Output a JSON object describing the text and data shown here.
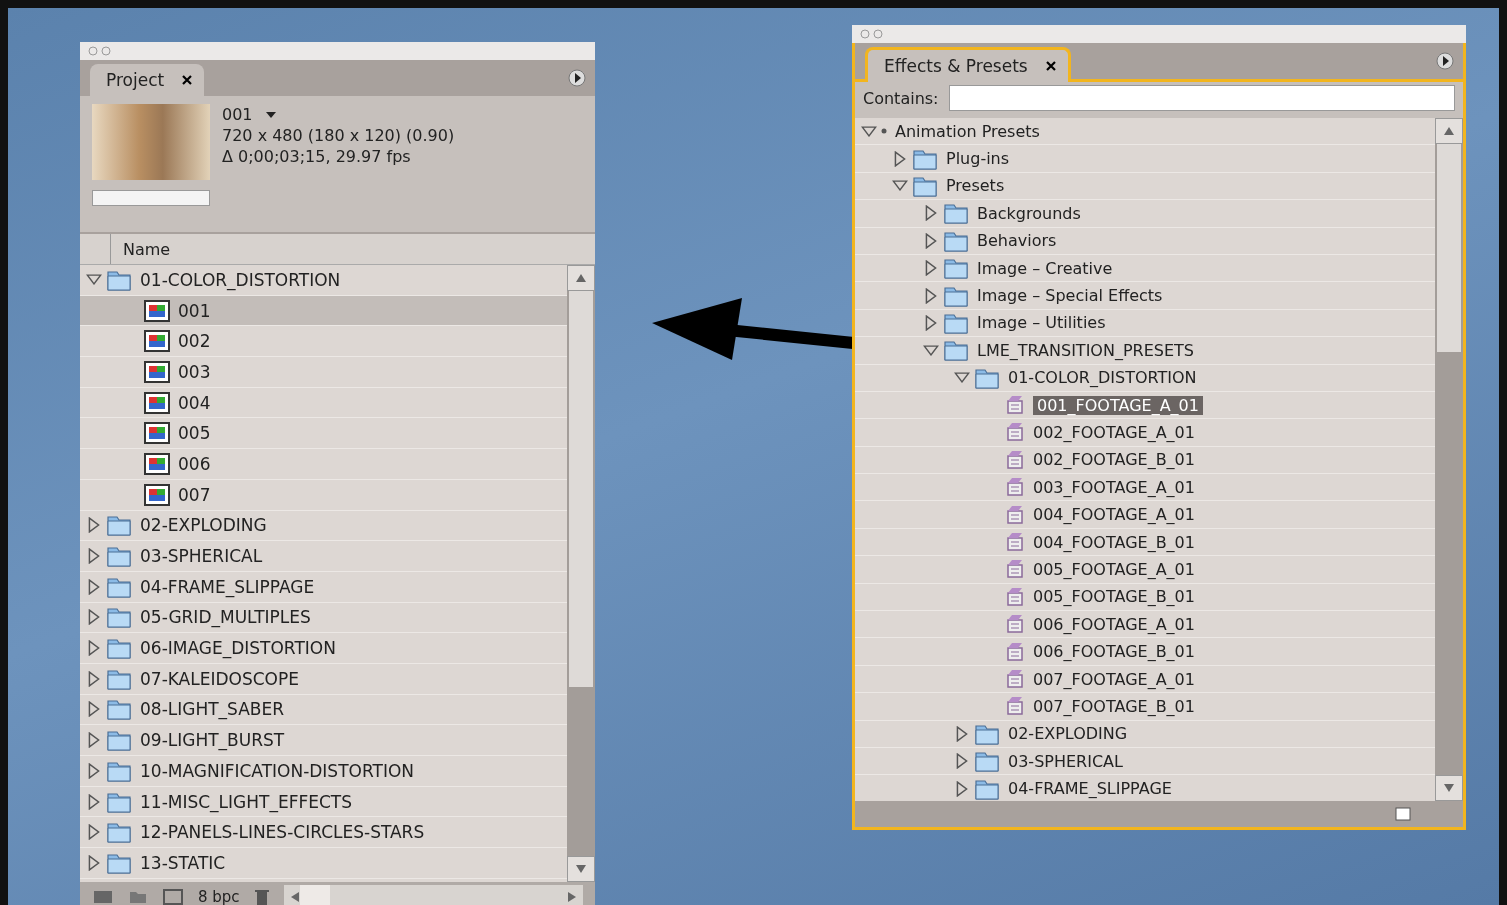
{
  "project_panel": {
    "tab": {
      "label": "Project"
    },
    "preview": {
      "name": "001",
      "dimensions": "720 x 480 (180 x 120) (0.90)",
      "duration": "Δ 0;00;03;15, 29.97 fps"
    },
    "column_header": "Name",
    "items": [
      {
        "label": "01-COLOR_DISTORTION",
        "kind": "folder",
        "expanded": true,
        "selected": false,
        "children": [
          {
            "label": "001",
            "kind": "footage",
            "selected": true
          },
          {
            "label": "002",
            "kind": "footage",
            "selected": false
          },
          {
            "label": "003",
            "kind": "footage",
            "selected": false
          },
          {
            "label": "004",
            "kind": "footage",
            "selected": false
          },
          {
            "label": "005",
            "kind": "footage",
            "selected": false
          },
          {
            "label": "006",
            "kind": "footage",
            "selected": false
          },
          {
            "label": "007",
            "kind": "footage",
            "selected": false
          }
        ]
      },
      {
        "label": "02-EXPLODING",
        "kind": "folder",
        "expanded": false,
        "selected": false
      },
      {
        "label": "03-SPHERICAL",
        "kind": "folder",
        "expanded": false,
        "selected": false
      },
      {
        "label": "04-FRAME_SLIPPAGE",
        "kind": "folder",
        "expanded": false,
        "selected": false
      },
      {
        "label": "05-GRID_MULTIPLES",
        "kind": "folder",
        "expanded": false,
        "selected": false
      },
      {
        "label": "06-IMAGE_DISTORTION",
        "kind": "folder",
        "expanded": false,
        "selected": false
      },
      {
        "label": "07-KALEIDOSCOPE",
        "kind": "folder",
        "expanded": false,
        "selected": false
      },
      {
        "label": "08-LIGHT_SABER",
        "kind": "folder",
        "expanded": false,
        "selected": false
      },
      {
        "label": "09-LIGHT_BURST",
        "kind": "folder",
        "expanded": false,
        "selected": false
      },
      {
        "label": "10-MAGNIFICATION-DISTORTION",
        "kind": "folder",
        "expanded": false,
        "selected": false
      },
      {
        "label": "11-MISC_LIGHT_EFFECTS",
        "kind": "folder",
        "expanded": false,
        "selected": false
      },
      {
        "label": "12-PANELS-LINES-CIRCLES-STARS",
        "kind": "folder",
        "expanded": false,
        "selected": false
      },
      {
        "label": "13-STATIC",
        "kind": "folder",
        "expanded": false,
        "selected": false
      }
    ],
    "footer": {
      "bit_depth": "8 bpc"
    }
  },
  "effects_panel": {
    "tab": {
      "label": "Effects & Presets"
    },
    "search": {
      "label": "Contains:"
    },
    "items": [
      {
        "label": "Animation Presets",
        "kind": "root",
        "expanded": true,
        "selected": false,
        "children": [
          {
            "label": "Plug-ins",
            "kind": "folder",
            "expanded": false,
            "selected": false
          },
          {
            "label": "Presets",
            "kind": "folder",
            "expanded": true,
            "selected": false,
            "children": [
              {
                "label": "Backgrounds",
                "kind": "folder",
                "expanded": false,
                "selected": false
              },
              {
                "label": "Behaviors",
                "kind": "folder",
                "expanded": false,
                "selected": false
              },
              {
                "label": "Image – Creative",
                "kind": "folder",
                "expanded": false,
                "selected": false
              },
              {
                "label": "Image – Special Effects",
                "kind": "folder",
                "expanded": false,
                "selected": false
              },
              {
                "label": "Image – Utilities",
                "kind": "folder",
                "expanded": false,
                "selected": false
              },
              {
                "label": "LME_TRANSITION_PRESETS",
                "kind": "folder",
                "expanded": true,
                "selected": false,
                "children": [
                  {
                    "label": "01-COLOR_DISTORTION",
                    "kind": "folder",
                    "expanded": true,
                    "selected": false,
                    "children": [
                      {
                        "label": "001_FOOTAGE_A_01",
                        "kind": "preset",
                        "selected": true
                      },
                      {
                        "label": "002_FOOTAGE_A_01",
                        "kind": "preset",
                        "selected": false
                      },
                      {
                        "label": "002_FOOTAGE_B_01",
                        "kind": "preset",
                        "selected": false
                      },
                      {
                        "label": "003_FOOTAGE_A_01",
                        "kind": "preset",
                        "selected": false
                      },
                      {
                        "label": "004_FOOTAGE_A_01",
                        "kind": "preset",
                        "selected": false
                      },
                      {
                        "label": "004_FOOTAGE_B_01",
                        "kind": "preset",
                        "selected": false
                      },
                      {
                        "label": "005_FOOTAGE_A_01",
                        "kind": "preset",
                        "selected": false
                      },
                      {
                        "label": "005_FOOTAGE_B_01",
                        "kind": "preset",
                        "selected": false
                      },
                      {
                        "label": "006_FOOTAGE_A_01",
                        "kind": "preset",
                        "selected": false
                      },
                      {
                        "label": "006_FOOTAGE_B_01",
                        "kind": "preset",
                        "selected": false
                      },
                      {
                        "label": "007_FOOTAGE_A_01",
                        "kind": "preset",
                        "selected": false
                      },
                      {
                        "label": "007_FOOTAGE_B_01",
                        "kind": "preset",
                        "selected": false
                      }
                    ]
                  },
                  {
                    "label": "02-EXPLODING",
                    "kind": "folder",
                    "expanded": false,
                    "selected": false
                  },
                  {
                    "label": "03-SPHERICAL",
                    "kind": "folder",
                    "expanded": false,
                    "selected": false
                  },
                  {
                    "label": "04-FRAME_SLIPPAGE",
                    "kind": "folder",
                    "expanded": false,
                    "selected": false
                  }
                ]
              }
            ]
          }
        ]
      }
    ]
  }
}
